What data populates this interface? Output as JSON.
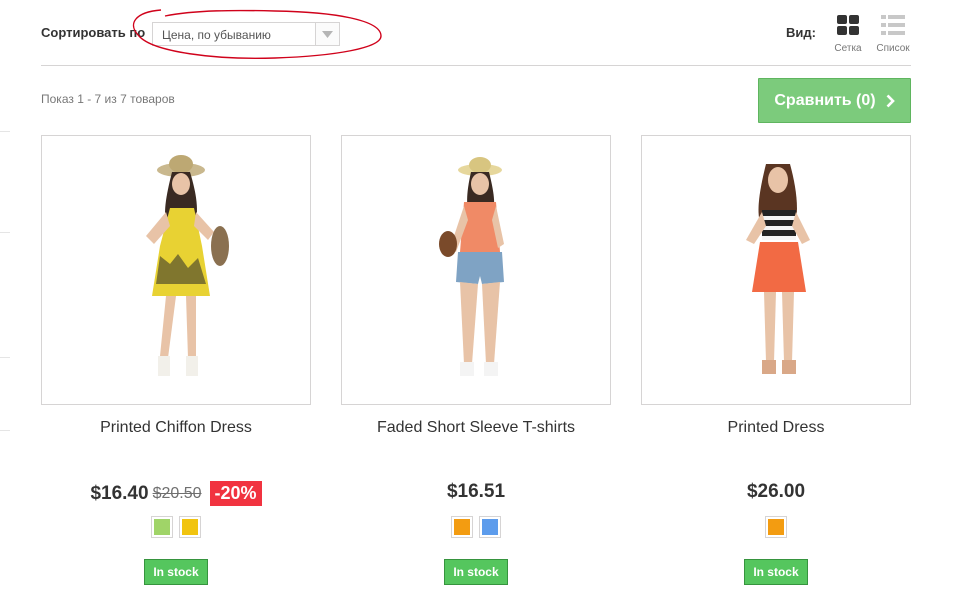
{
  "toolbar": {
    "sort_label": "Сортировать по",
    "sort_value": "Цена, по убыванию",
    "view_label": "Вид:",
    "view_grid_label": "Сетка",
    "view_list_label": "Список"
  },
  "listing": {
    "count_text": "Показ 1 - 7 из 7 товаров",
    "compare_label": "Сравнить (0)"
  },
  "products": [
    {
      "name": "Printed Chiffon Dress",
      "price": "$16.40",
      "old_price": "$20.50",
      "discount": "-20%",
      "colors": [
        "#a0d468",
        "#f1c40f"
      ],
      "stock": "In stock"
    },
    {
      "name": "Faded Short Sleeve T-shirts",
      "price": "$16.51",
      "colors": [
        "#f39c11",
        "#5d9cec"
      ],
      "stock": "In stock"
    },
    {
      "name": "Printed Dress",
      "price": "$26.00",
      "colors": [
        "#f39c11"
      ],
      "stock": "In stock"
    }
  ],
  "theme": {
    "compare_green": "#7ccb7c",
    "stock_green": "#55c65e",
    "discount_red": "#f13340",
    "annotation_red": "#d0021b"
  }
}
